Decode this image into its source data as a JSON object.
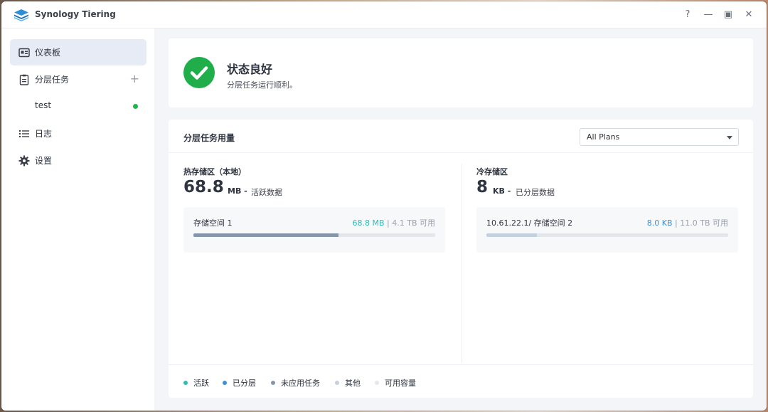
{
  "window": {
    "title": "Synology Tiering",
    "controls": {
      "help": "?",
      "minimize": "—",
      "maximize": "▣",
      "close": "✕"
    }
  },
  "sidebar": {
    "items": [
      {
        "label": "仪表板",
        "icon": "dashboard-icon",
        "active": true
      },
      {
        "label": "分层任务",
        "icon": "clipboard-icon",
        "action": "+"
      },
      {
        "label": "test",
        "status_color": "#21b24b"
      },
      {
        "label": "日志",
        "icon": "list-icon"
      },
      {
        "label": "设置",
        "icon": "gear-icon"
      }
    ]
  },
  "status": {
    "title": "状态良好",
    "subtitle": "分层任务运行顺利。",
    "icon": "check-circle-icon",
    "color": "#1fae4a"
  },
  "usage": {
    "title": "分层任务用量",
    "plan_select": {
      "value": "All Plans"
    },
    "hot": {
      "title": "热存储区（本地）",
      "value": "68.8",
      "unit": "MB -",
      "desc": "活跃数据",
      "volume": {
        "name": "存储空间 1",
        "used": "68.8 MB",
        "sep": " | ",
        "free": "4.1 TB 可用",
        "used_color": "#2ebcb6",
        "bar_fraction": 0.6,
        "bar_color": "#8396aa"
      }
    },
    "cold": {
      "title": "冷存储区",
      "value": "8",
      "unit": "KB -",
      "desc": "已分层数据",
      "volume": {
        "name": "10.61.22.1/ 存储空间 2",
        "used": "8.0 KB",
        "sep": " | ",
        "free": "11.0 TB 可用",
        "used_color": "#3a8fd6",
        "bar_fraction": 0.21,
        "bar_color": "#c3d1de"
      }
    },
    "legend": [
      {
        "label": "活跃",
        "color": "#2ebcb6"
      },
      {
        "label": "已分层",
        "color": "#3a8fd6"
      },
      {
        "label": "未应用任务",
        "color": "#8396aa"
      },
      {
        "label": "其他",
        "color": "#c3d1de"
      },
      {
        "label": "可用容量",
        "color": "#e3e7ec"
      }
    ]
  }
}
